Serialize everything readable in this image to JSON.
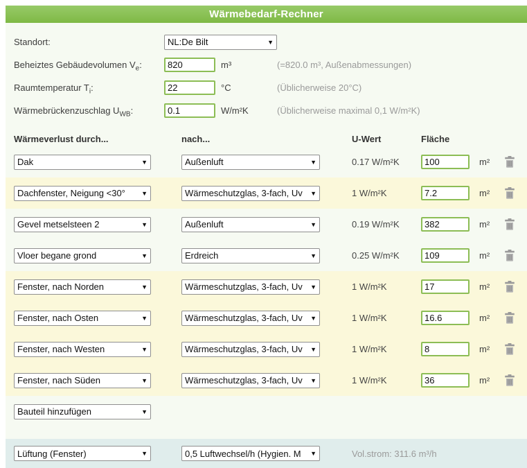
{
  "header": {
    "title": "Wärmebedarf-Rechner"
  },
  "icons": {
    "dropdown_arrow": "▼"
  },
  "colors": {
    "header_green": "#8bc152",
    "input_border_green": "#8cbd55",
    "row_highlight_yellow": "#fbf8da",
    "ventilation_bg": "#e0edec",
    "content_bg": "#f6faf2",
    "note_gray": "#9a9a9a"
  },
  "form": {
    "location": {
      "label": "Standort:",
      "value": "NL:De Bilt"
    },
    "volume": {
      "label": "Beheiztes Gebäudevolumen V",
      "label_sub": "e",
      "label_suffix": ":",
      "value": "820",
      "unit": "m³",
      "note": "(=820.0 m³, Außenabmessungen)"
    },
    "temperature": {
      "label": "Raumtemperatur T",
      "label_sub": "i",
      "label_suffix": ":",
      "value": "22",
      "unit": "°C",
      "note": "(Üblicherweise 20°C)"
    },
    "thermal_bridge": {
      "label": "Wärmebrückenzuschlag U",
      "label_sub": "WB",
      "label_suffix": ":",
      "value": "0.1",
      "unit": "W/m²K",
      "note": "(Üblicherweise maximal 0,1 W/m²K)"
    }
  },
  "table": {
    "headers": {
      "component": "Wärmeverlust durch...",
      "target": "nach...",
      "u_value": "U-Wert",
      "area": "Fläche"
    },
    "area_unit": "m²",
    "rows": [
      {
        "component": "Dak",
        "target": "Außenluft",
        "u_value": "0.17 W/m²K",
        "area": "100",
        "highlighted": false
      },
      {
        "component": "Dachfenster, Neigung <30°",
        "target": "Wärmeschutzglas, 3-fach, Uv",
        "u_value": "1 W/m²K",
        "area": "7.2",
        "highlighted": true
      },
      {
        "component": "Gevel metselsteen 2",
        "target": "Außenluft",
        "u_value": "0.19 W/m²K",
        "area": "382",
        "highlighted": false
      },
      {
        "component": "Vloer begane grond",
        "target": "Erdreich",
        "u_value": "0.25 W/m²K",
        "area": "109",
        "highlighted": false
      },
      {
        "component": "Fenster, nach Norden",
        "target": "Wärmeschutzglas, 3-fach, Uv",
        "u_value": "1 W/m²K",
        "area": "17",
        "highlighted": true
      },
      {
        "component": "Fenster, nach Osten",
        "target": "Wärmeschutzglas, 3-fach, Uv",
        "u_value": "1 W/m²K",
        "area": "16.6",
        "highlighted": true
      },
      {
        "component": "Fenster, nach Westen",
        "target": "Wärmeschutzglas, 3-fach, Uv",
        "u_value": "1 W/m²K",
        "area": "8",
        "highlighted": true
      },
      {
        "component": "Fenster, nach Süden",
        "target": "Wärmeschutzglas, 3-fach, Uv",
        "u_value": "1 W/m²K",
        "area": "36",
        "highlighted": true
      }
    ],
    "add_component_label": "Bauteil hinzufügen"
  },
  "ventilation": {
    "type": "Lüftung (Fenster)",
    "rate": "0,5 Luftwechsel/h (Hygien. M",
    "volume_flow": "Vol.strom: 311.6 m³/h"
  }
}
